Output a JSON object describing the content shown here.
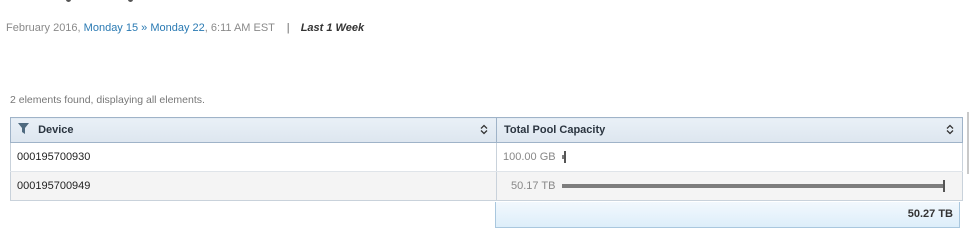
{
  "header": {
    "date_prefix": "February 2016,",
    "start_link": "Monday 15",
    "separator": "»",
    "end_link": "Monday 22",
    "time_suffix": ", 6:11 AM EST",
    "divider": "|",
    "range_label": "Last 1 Week"
  },
  "results": {
    "summary": "2 elements found, displaying all elements."
  },
  "table": {
    "columns": [
      {
        "label": "Device",
        "icon": "filter-icon",
        "sortable": true
      },
      {
        "label": "Total Pool Capacity",
        "sortable": true
      }
    ],
    "rows": [
      {
        "device": "000195700930",
        "capacity": "100.00 GB",
        "capacity_fraction": 0.002
      },
      {
        "device": "000195700949",
        "capacity": "50.17 TB",
        "capacity_fraction": 0.998
      }
    ],
    "total": "50.27 TB"
  },
  "colors": {
    "link": "#2a7ab3",
    "bar": "#7d7d7d",
    "header_border": "#9fb3c8"
  }
}
